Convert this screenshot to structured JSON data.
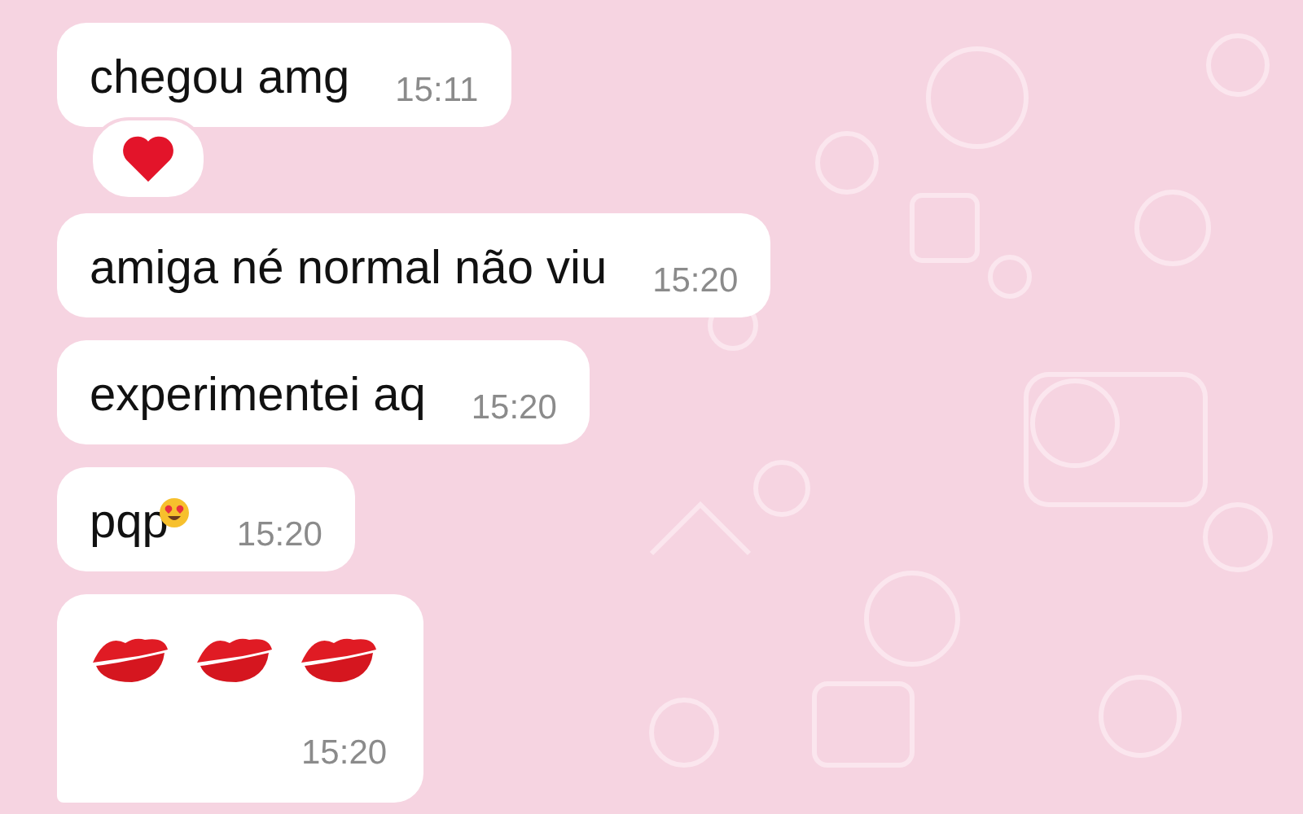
{
  "messages": [
    {
      "kind": "text",
      "text": "chegou amg",
      "time": "15:11",
      "has_reaction": true
    },
    {
      "kind": "text",
      "text": "amiga né normal não viu",
      "time": "15:20",
      "has_reaction": false
    },
    {
      "kind": "text",
      "text": "experimentei aq",
      "time": "15:20",
      "has_reaction": false
    },
    {
      "kind": "text-emoji",
      "text": "pqp",
      "time": "15:20",
      "has_reaction": false
    },
    {
      "kind": "kisses",
      "time": "15:20",
      "has_reaction": false
    }
  ]
}
